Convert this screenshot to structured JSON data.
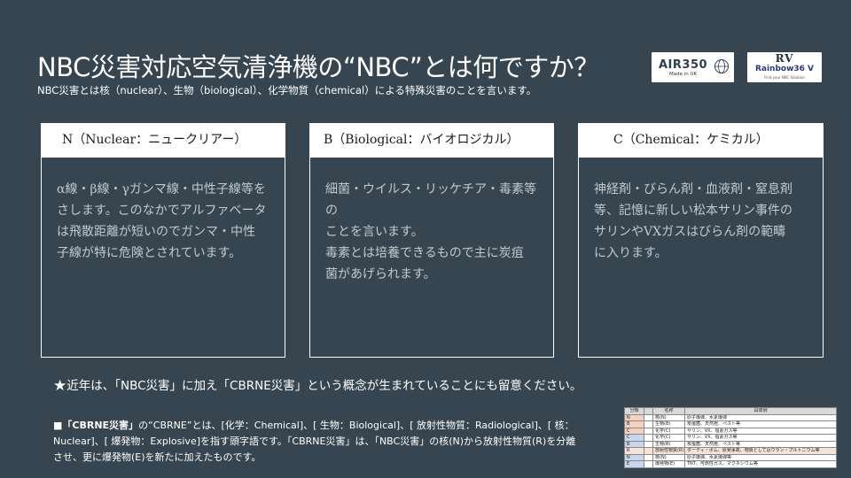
{
  "title": "NBC災害対応空気清浄機の“NBC”とは何ですか？",
  "subtitle": "NBC災害とは核（nuclear）、生物（biological）、化学物質（chemical）による特殊災害のことを言います。",
  "logos": {
    "air": {
      "main": "AIR350",
      "sub": "Made in UK"
    },
    "rv": {
      "mark": "RV",
      "brand": "Rainbow36 V",
      "tag": "Find your NBC Solution"
    }
  },
  "cards": [
    {
      "heading": "N（Nuclear：ニュークリアー）",
      "body": [
        "α線・β線・γガンマ線・中性子線等を",
        "さします。このなかでアルファベータ",
        "は飛散距離が短いのでガンマ・中性",
        "子線が特に危険とされています。"
      ]
    },
    {
      "heading": "B（Biological：バイオロジカル）",
      "body": [
        "細菌・ウイルス・リッケチア・毒素等の",
        "ことを言います。",
        "毒素とは培養できるもので主に炭疽",
        "菌があげられます。"
      ]
    },
    {
      "heading": "C（Chemical：ケミカル）",
      "body": [
        "神経剤・びらん剤・血液剤・窒息剤",
        "等、記憶に新しい松本サリン事件の",
        "サリンやVXガスはびらん剤の範疇",
        "に入ります。"
      ]
    }
  ],
  "note": {
    "star": "★",
    "text": "近年は、「NBC災害」に加え「CBRNE災害」という概念が生まれていることにも留意ください。"
  },
  "paragraph": {
    "bullet": "■",
    "lead": "「CBRNE災害」",
    "text": "の“CBRNE”とは、[化学：Chemical]、[ 生物：Biological]、[ 放射性物質：Radiological]、[ 核：Nuclear]、[ 爆発物：Explosive]を指す頭字語です。「CBRNE災害」は、「NBC災害」の核(N)から放射性物質(R)を分離させ、更に爆発物(E)を新たに加えたものです。"
  },
  "table": {
    "headers": [
      "分類",
      "",
      "名称",
      "具体例"
    ],
    "rows": [
      {
        "group": "N",
        "code": "",
        "name": "核(N)",
        "example": "原子爆弾、水素爆弾",
        "kind": "nbc"
      },
      {
        "group": "B",
        "code": "",
        "name": "生物(B)",
        "example": "炭疽菌、天然痘、ペスト等",
        "kind": "nbc"
      },
      {
        "group": "C",
        "code": "",
        "name": "化学(C)",
        "example": "サリン、VX、塩素ガス等",
        "kind": "nbc"
      },
      {
        "group": "C",
        "code": "",
        "name": "化学(C)",
        "example": "サリン、VX、塩素ガス等",
        "kind": "cb"
      },
      {
        "group": "B",
        "code": "",
        "name": "生物(B)",
        "example": "炭疽菌、天然痘、ペスト等",
        "kind": "cb"
      },
      {
        "group": "R",
        "code": "",
        "name": "放射性物質(R)",
        "example": "ダーティ・ボム、原発事故、物質としてはウラン・プルトニウム等",
        "kind": "rad"
      },
      {
        "group": "N",
        "code": "",
        "name": "核(N)",
        "example": "原子爆弾、水素爆弾等",
        "kind": "cb"
      },
      {
        "group": "E",
        "code": "",
        "name": "爆発物(E)",
        "example": "TNT、可燃性ガス、マグネシウム等",
        "kind": "cb"
      }
    ]
  }
}
